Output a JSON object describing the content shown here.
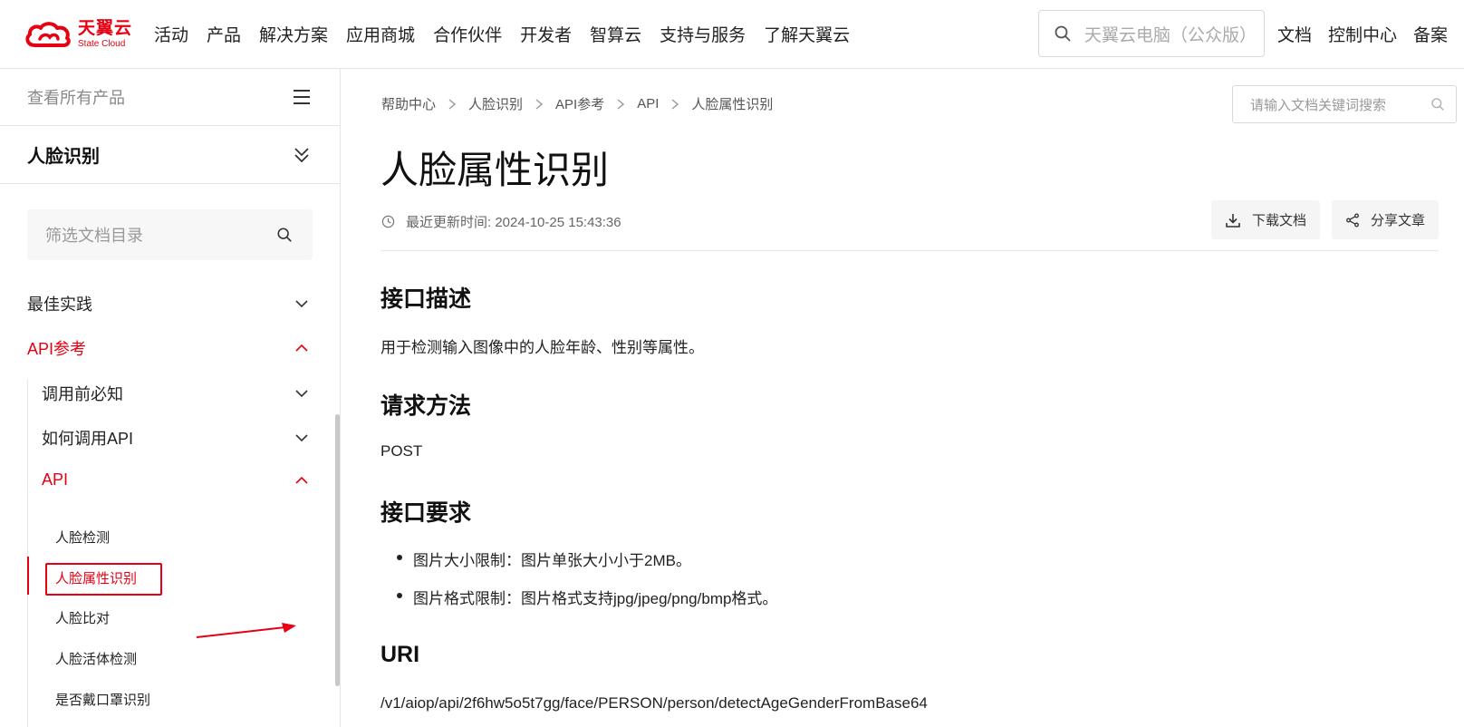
{
  "brand": {
    "name_cn": "天翼云",
    "name_en": "State Cloud",
    "color": "#e60012"
  },
  "nav": {
    "links": [
      "活动",
      "产品",
      "解决方案",
      "应用商城",
      "合作伙伴",
      "开发者",
      "智算云",
      "支持与服务",
      "了解天翼云"
    ],
    "search_placeholder": "天翼云电脑（公众版）",
    "right_links": [
      "文档",
      "控制中心",
      "备案"
    ]
  },
  "sidebar": {
    "all_products": "查看所有产品",
    "product": "人脸识别",
    "filter_placeholder": "筛选文档目录",
    "items": [
      {
        "label": "最佳实践",
        "state": "collapsed"
      },
      {
        "label": "API参考",
        "state": "expanded"
      },
      {
        "label": "调用前必知",
        "state": "collapsed"
      },
      {
        "label": "如何调用API",
        "state": "collapsed"
      },
      {
        "label": "API",
        "state": "expanded"
      }
    ],
    "sub_items": [
      "人脸检测",
      "人脸属性识别",
      "人脸比对",
      "人脸活体检测",
      "是否戴口罩识别"
    ],
    "active_sub_index": 1
  },
  "content": {
    "breadcrumb": [
      "帮助中心",
      "人脸识别",
      "API参考",
      "API",
      "人脸属性识别"
    ],
    "doc_search_placeholder": "请输入文档关键词搜索",
    "title": "人脸属性识别",
    "updated_label": "最近更新时间: 2024-10-25 15:43:36",
    "download_label": "下载文档",
    "share_label": "分享文章",
    "sections": {
      "desc_title": "接口描述",
      "desc_text": "用于检测输入图像中的人脸年龄、性别等属性。",
      "method_title": "请求方法",
      "method_text": "POST",
      "req_title": "接口要求",
      "req_items": [
        "图片大小限制：图片单张大小小于2MB。",
        "图片格式限制：图片格式支持jpg/jpeg/png/bmp格式。"
      ],
      "uri_title": "URI",
      "uri_text": "/v1/aiop/api/2f6hw5o5t7gg/face/PERSON/person/detectAgeGenderFromBase64"
    }
  }
}
